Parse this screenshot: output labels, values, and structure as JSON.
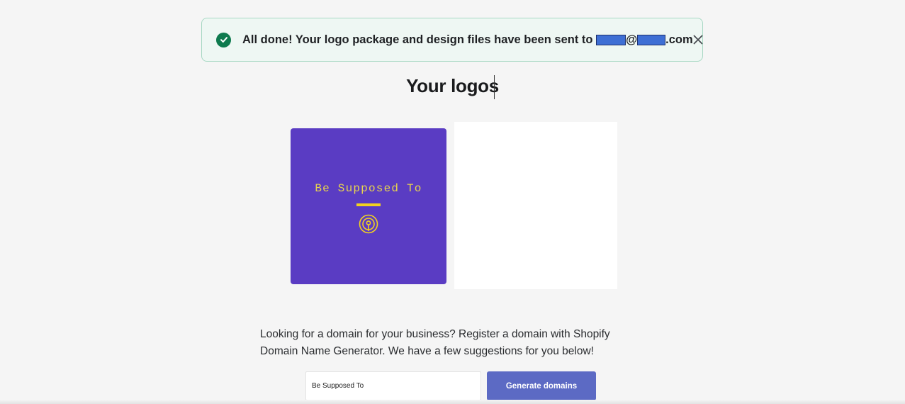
{
  "banner": {
    "message_prefix": "All done! Your logo package and design files have been sent to",
    "at_sign": "@",
    "email_suffix": ".com",
    "icons": [
      "check-circle-icon",
      "close-icon"
    ]
  },
  "page": {
    "title": "Your logos"
  },
  "logo": {
    "text": "Be Supposed To",
    "background_color": "#5a3cc3",
    "text_color": "#e8d44d",
    "accent_color": "#f2d21e",
    "icon": "broadcast-icon"
  },
  "domain": {
    "description": "Looking for a domain for your business? Register a domain with Shopify Domain Name Generator. We have a few suggestions for you below!",
    "input_value": "Be Supposed To",
    "button_label": "Generate domains",
    "button_color": "#5c6ac4"
  }
}
